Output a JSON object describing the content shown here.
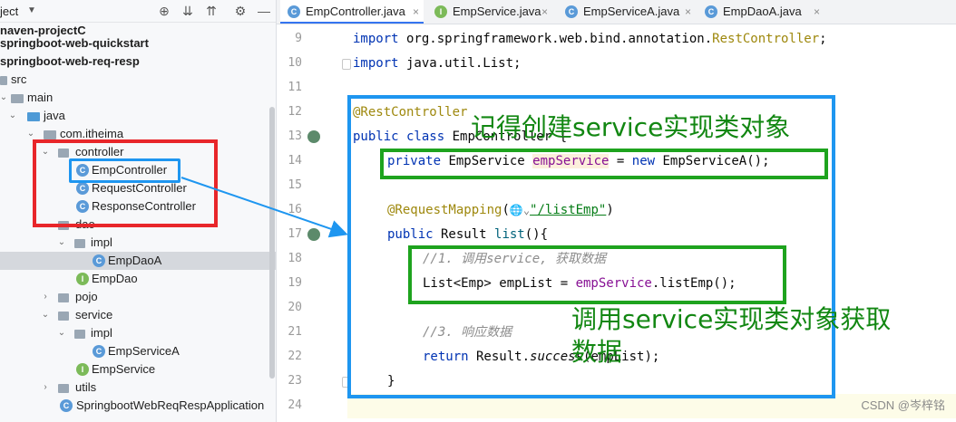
{
  "project_panel": {
    "title": "ject",
    "rows": [
      {
        "label": "naven-projectC",
        "bold": true
      },
      {
        "label": "springboot-web-quickstart",
        "bold": true
      },
      {
        "label": "springboot-web-req-resp",
        "bold": true
      },
      {
        "label": "src"
      },
      {
        "label": "main"
      },
      {
        "label": "java"
      },
      {
        "label": "com.itheima"
      },
      {
        "label": "controller"
      },
      {
        "label": "EmpController"
      },
      {
        "label": "RequestController"
      },
      {
        "label": "ResponseController"
      },
      {
        "label": "dao"
      },
      {
        "label": "impl"
      },
      {
        "label": "EmpDaoA"
      },
      {
        "label": "EmpDao"
      },
      {
        "label": "pojo"
      },
      {
        "label": "service"
      },
      {
        "label": "impl"
      },
      {
        "label": "EmpServiceA"
      },
      {
        "label": "EmpService"
      },
      {
        "label": "utils"
      },
      {
        "label": "SpringbootWebReqRespApplication"
      }
    ]
  },
  "tabs": [
    {
      "label": "EmpController.java",
      "active": true
    },
    {
      "label": "EmpService.java"
    },
    {
      "label": "EmpServiceA.java"
    },
    {
      "label": "EmpDaoA.java"
    }
  ],
  "line_numbers": [
    "9",
    "10",
    "11",
    "12",
    "13",
    "14",
    "15",
    "16",
    "17",
    "18",
    "19",
    "20",
    "21",
    "22",
    "23",
    "24"
  ],
  "code": {
    "l9_kw": "import",
    "l9_a": " org.springframework.web.bind.annotation.",
    "l9_b": "RestController",
    "l9_c": ";",
    "l10_kw": "import",
    "l10_a": " java.util.List;",
    "l12_ann": "@RestController",
    "l13_kw": "public class",
    "l13_name": " EmpController {",
    "l14_kw": "private",
    "l14_a": " EmpService ",
    "l14_fld": "empService",
    "l14_b": " = ",
    "l14_kw2": "new",
    "l14_c": " EmpServiceA();",
    "l16_ann": "@RequestMapping",
    "l16_a": "(",
    "l16_icon": "🌐⌄",
    "l16_str": "\"/listEmp\"",
    "l16_b": ")",
    "l17_kw": "public",
    "l17_a": " Result ",
    "l17_meth": "list",
    "l17_b": "(){",
    "l18_cmt": "//1. 调用service, 获取数据",
    "l19_a": "List<Emp> empList = ",
    "l19_fld": "empService",
    "l19_b": ".listEmp();",
    "l21_cmt": "//3. 响应数据",
    "l22_kw": "return",
    "l22_a": " Result.",
    "l22_meth": "success",
    "l22_b": "(empList);",
    "l23": "}"
  },
  "annotations": {
    "callout_top": "记得创建service实现类对象",
    "callout_bottom_1": "调用service实现类对象获取",
    "callout_bottom_2": "数据"
  },
  "watermark": "CSDN @岑梓铭",
  "colors": {
    "red_box": "#e8262a",
    "blue_box": "#1e96f0",
    "green_box": "#1ea31e",
    "green_text": "#128712"
  }
}
